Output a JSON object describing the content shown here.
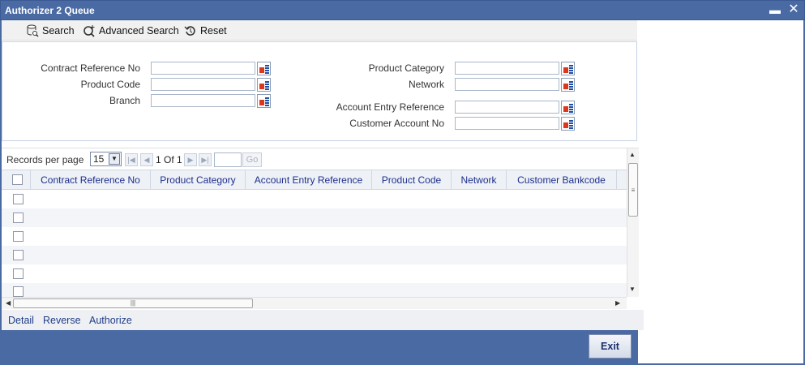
{
  "window": {
    "title": "Authorizer 2 Queue",
    "minimize_glyph": "▬",
    "close_glyph": "✕"
  },
  "toolbar": {
    "search": "Search",
    "advanced_search": "Advanced Search",
    "reset": "Reset"
  },
  "search_fields": {
    "contract_reference_no": {
      "label": "Contract Reference No",
      "value": ""
    },
    "product_code": {
      "label": "Product Code",
      "value": ""
    },
    "branch": {
      "label": "Branch",
      "value": ""
    },
    "product_category": {
      "label": "Product Category",
      "value": ""
    },
    "network": {
      "label": "Network",
      "value": ""
    },
    "account_entry_reference": {
      "label": "Account Entry Reference",
      "value": ""
    },
    "customer_account_no": {
      "label": "Customer Account No",
      "value": ""
    }
  },
  "pager": {
    "records_per_page_label": "Records per page",
    "records_per_page": "15",
    "page_info": "1 Of 1",
    "go": "Go"
  },
  "grid": {
    "columns": [
      "Contract Reference No",
      "Product Category",
      "Account Entry Reference",
      "Product Code",
      "Network",
      "Customer Bankcode"
    ]
  },
  "actions": {
    "detail": "Detail",
    "reverse": "Reverse",
    "authorize": "Authorize"
  },
  "footer": {
    "exit": "Exit"
  },
  "colors": {
    "titlebar": "#4a6aa4",
    "header_text": "#1c2f8c",
    "link": "#1f3c88"
  }
}
